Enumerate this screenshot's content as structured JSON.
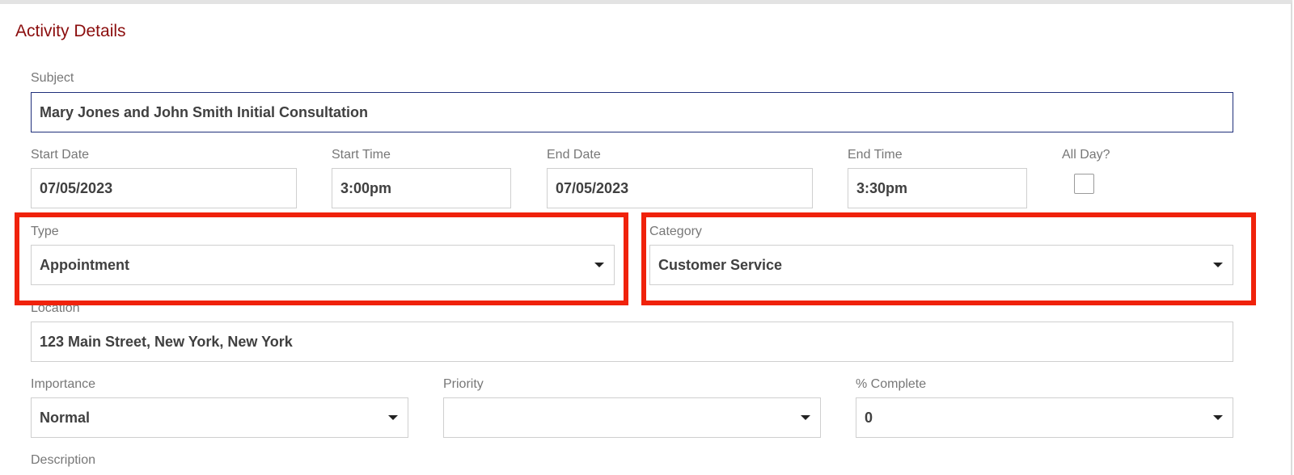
{
  "section": {
    "title": "Activity Details"
  },
  "subject": {
    "label": "Subject",
    "value": "Mary Jones and John Smith Initial Consultation"
  },
  "start_date": {
    "label": "Start Date",
    "value": "07/05/2023"
  },
  "start_time": {
    "label": "Start Time",
    "value": "3:00pm"
  },
  "end_date": {
    "label": "End Date",
    "value": "07/05/2023"
  },
  "end_time": {
    "label": "End Time",
    "value": "3:30pm"
  },
  "all_day": {
    "label": "All Day?",
    "checked": false
  },
  "type": {
    "label": "Type",
    "value": "Appointment",
    "icon": "chevron-down-icon"
  },
  "category": {
    "label": "Category",
    "value": "Customer Service",
    "icon": "chevron-down-icon"
  },
  "location": {
    "label": "Location",
    "value": "123 Main Street, New York, New York"
  },
  "importance": {
    "label": "Importance",
    "value": "Normal",
    "icon": "chevron-down-icon"
  },
  "priority": {
    "label": "Priority",
    "value": "",
    "icon": "chevron-down-icon"
  },
  "percent_complete": {
    "label": "% Complete",
    "value": "0",
    "icon": "chevron-down-icon"
  },
  "description": {
    "label": "Description"
  },
  "colors": {
    "title": "#8b0d0d",
    "highlight": "#f0220b",
    "focus_border": "#1f2f7a",
    "label": "#777777",
    "value": "#404040"
  }
}
